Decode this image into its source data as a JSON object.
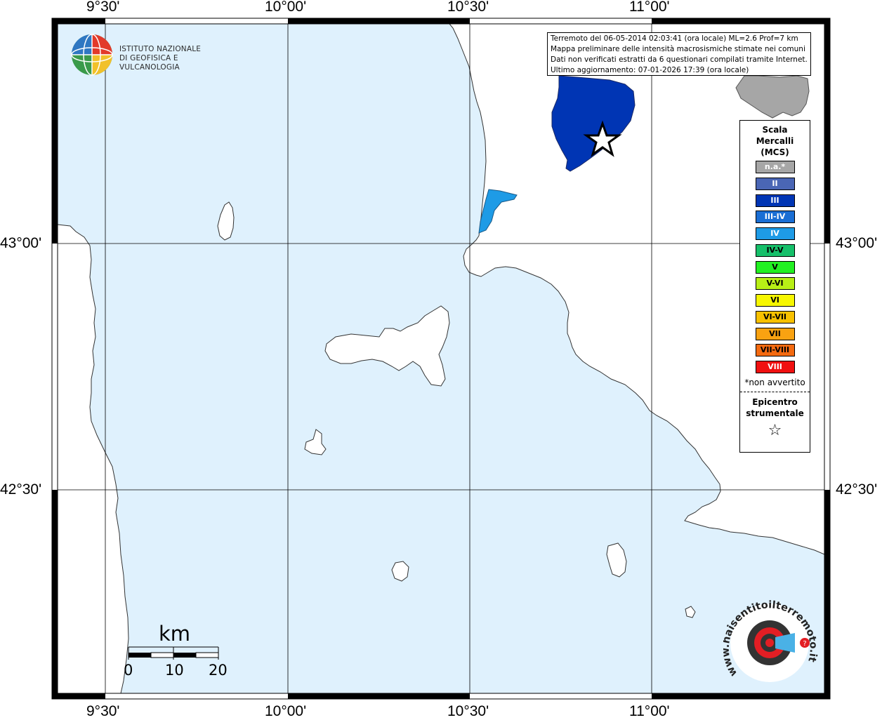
{
  "map": {
    "top_ticks": [
      "9°30'",
      "10°00'",
      "10°30'",
      "11°00'"
    ],
    "bottom_ticks": [
      "9°30'",
      "10°00'",
      "10°30'",
      "11°00'"
    ],
    "left_ticks": [
      "43°00'",
      "42°30'"
    ],
    "right_ticks": [
      "43°00'",
      "42°30'"
    ]
  },
  "info": {
    "line1": "Terremoto del 06-05-2014 02:03:41 (ora locale) ML=2.6 Prof=7 km",
    "line2": "Mappa preliminare delle intensità macrosismiche stimate nei comuni",
    "line3": "Dati non verificati estratti da 6 questionari compilati tramite Internet.",
    "line4": "Ultimo aggiornamento: 07-01-2026 17:39 (ora locale)"
  },
  "logo": {
    "line1": "ISTITUTO NAZIONALE",
    "line2": "DI GEOFISICA E VULCANOLOGIA",
    "icon": "ingv-globe-icon"
  },
  "legend": {
    "title": "Scala\nMercalli\n(MCS)",
    "items": [
      {
        "label": "n.a.*",
        "color": "#a6a6a6",
        "dark": false
      },
      {
        "label": "II",
        "color": "#4a66b5",
        "dark": false
      },
      {
        "label": "III",
        "color": "#0035b4",
        "dark": false
      },
      {
        "label": "III-IV",
        "color": "#1a6ed4",
        "dark": false
      },
      {
        "label": "IV",
        "color": "#1e9be6",
        "dark": false
      },
      {
        "label": "IV-V",
        "color": "#16c06a",
        "dark": true
      },
      {
        "label": "V",
        "color": "#22f022",
        "dark": true
      },
      {
        "label": "V-VI",
        "color": "#b8ef16",
        "dark": true
      },
      {
        "label": "VI",
        "color": "#f7f700",
        "dark": true
      },
      {
        "label": "VI-VII",
        "color": "#f8c100",
        "dark": true
      },
      {
        "label": "VII",
        "color": "#f9a211",
        "dark": true
      },
      {
        "label": "VII-VIII",
        "color": "#f46a10",
        "dark": true
      },
      {
        "label": "VIII",
        "color": "#f01010",
        "dark": false
      }
    ],
    "note": "*non avvertito",
    "epicentre": "Epicentro\nstrumentale",
    "star": "☆"
  },
  "scale": {
    "unit": "km",
    "labels": [
      "0",
      "10",
      "20"
    ]
  },
  "brand": {
    "text": "www.haisentitoilterremoto.it",
    "icon": "hai-sentito-il-terremoto-logo-icon"
  },
  "colors": {
    "sea": "#dff1fd",
    "land": "#ffffff",
    "intensity_iii": "#0035b4",
    "intensity_iv": "#1e9be6",
    "not_available": "#a6a6a6"
  }
}
